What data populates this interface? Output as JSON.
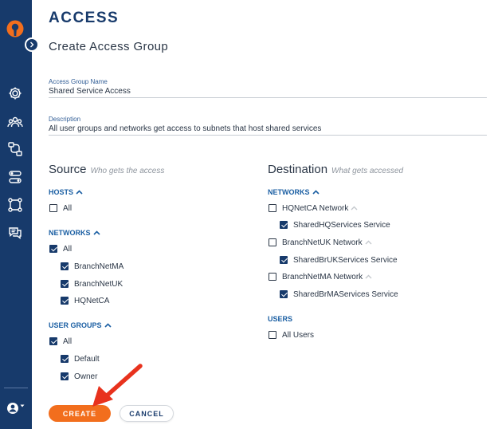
{
  "app": {
    "title": "ACCESS"
  },
  "page": {
    "title": "Create Access Group"
  },
  "form": {
    "name": {
      "label": "Access Group Name",
      "value": "Shared Service Access"
    },
    "description": {
      "label": "Description",
      "value": "All user groups and networks get access to subnets that host shared services"
    }
  },
  "sidebar": {
    "items": [
      {
        "icon": "gear-icon"
      },
      {
        "icon": "users-icon"
      },
      {
        "icon": "network-icon"
      },
      {
        "icon": "services-icon"
      },
      {
        "icon": "topology-icon"
      },
      {
        "icon": "messages-icon"
      }
    ],
    "user_menu_icon": "user-circle-icon"
  },
  "source": {
    "title": "Source",
    "subtitle": "Who gets the access",
    "hosts": {
      "heading": "HOSTS",
      "items": [
        {
          "label": "All",
          "checked": false
        }
      ]
    },
    "networks": {
      "heading": "NETWORKS",
      "items": [
        {
          "label": "All",
          "checked": true
        },
        {
          "label": "BranchNetMA",
          "checked": true
        },
        {
          "label": "BranchNetUK",
          "checked": true
        },
        {
          "label": "HQNetCA",
          "checked": true
        }
      ]
    },
    "user_groups": {
      "heading": "USER GROUPS",
      "items": [
        {
          "label": "All",
          "checked": true
        },
        {
          "label": "Default",
          "checked": true
        },
        {
          "label": "Owner",
          "checked": true
        }
      ]
    }
  },
  "destination": {
    "title": "Destination",
    "subtitle": "What gets accessed",
    "networks": {
      "heading": "NETWORKS",
      "items": [
        {
          "label": "HQNetCA Network",
          "checked": false
        },
        {
          "label": "SharedHQServices Service",
          "checked": true
        },
        {
          "label": "BranchNetUK Network",
          "checked": false
        },
        {
          "label": "SharedBrUKServices Service",
          "checked": true
        },
        {
          "label": "BranchNetMA Network",
          "checked": false
        },
        {
          "label": "SharedBrMAServices Service",
          "checked": true
        }
      ]
    },
    "users": {
      "heading": "USERS",
      "items": [
        {
          "label": "All Users",
          "checked": false
        }
      ]
    }
  },
  "actions": {
    "create_label": "CREATE",
    "cancel_label": "CANCEL"
  },
  "colors": {
    "sidebar": "#173a6b",
    "accent": "#f26e1d",
    "section_heading": "#1b5fa3",
    "annotation_arrow": "#e8321d"
  }
}
